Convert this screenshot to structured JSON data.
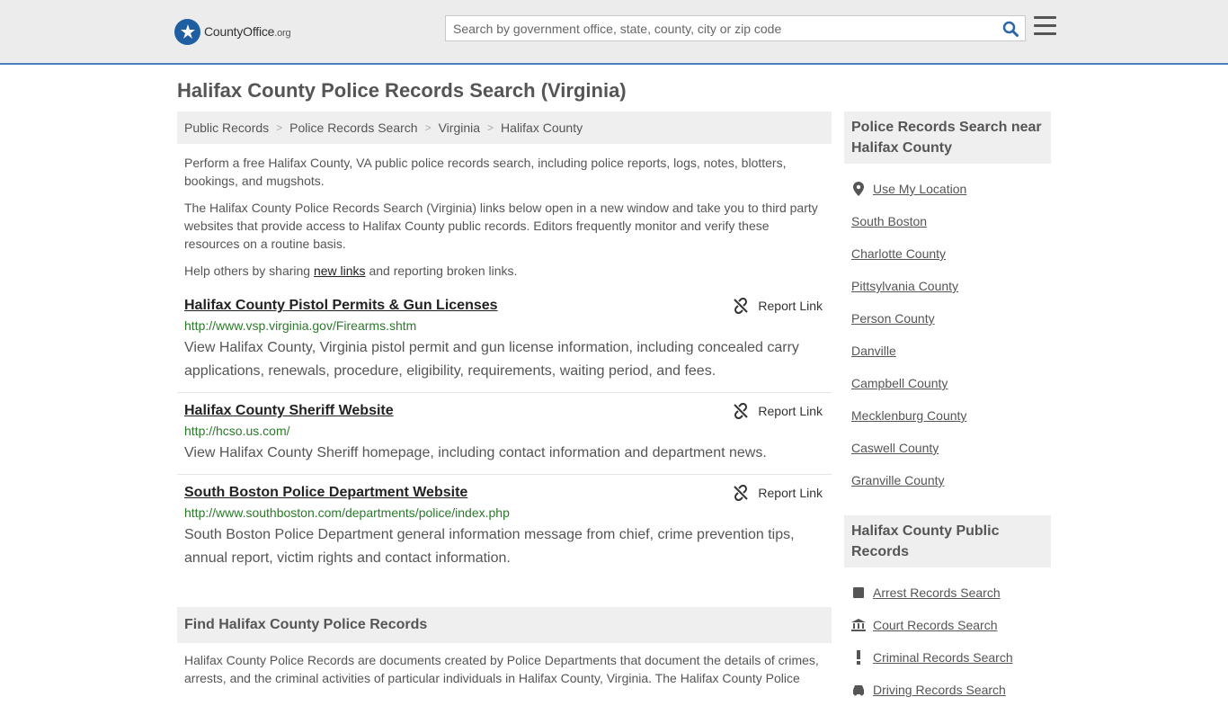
{
  "header": {
    "logo_text": "CountyOffice",
    "logo_tld": ".org",
    "search_placeholder": "Search by government office, state, county, city or zip code"
  },
  "page": {
    "title": "Halifax County Police Records Search (Virginia)"
  },
  "breadcrumb": [
    "Public Records",
    "Police Records Search",
    "Virginia",
    "Halifax County"
  ],
  "intro": {
    "p1": "Perform a free Halifax County, VA public police records search, including police reports, logs, notes, blotters, bookings, and mugshots.",
    "p2": "The Halifax County Police Records Search (Virginia) links below open in a new window and take you to third party websites that provide access to Halifax County public records. Editors frequently monitor and verify these resources on a routine basis.",
    "p3_before": "Help others by sharing ",
    "p3_link": "new links",
    "p3_after": " and reporting broken links."
  },
  "report_label": "Report Link",
  "results": [
    {
      "title": "Halifax County Pistol Permits & Gun Licenses",
      "url": "http://www.vsp.virginia.gov/Firearms.shtm",
      "desc": "View Halifax County, Virginia pistol permit and gun license information, including concealed carry applications, renewals, procedure, eligibility, requirements, waiting period, and fees."
    },
    {
      "title": "Halifax County Sheriff Website",
      "url": "http://hcso.us.com/",
      "desc": "View Halifax County Sheriff homepage, including contact information and department news."
    },
    {
      "title": "South Boston Police Department Website",
      "url": "http://www.southboston.com/departments/police/index.php",
      "desc": "South Boston Police Department general information message from chief, crime prevention tips, annual report, victim rights and contact information."
    }
  ],
  "find": {
    "heading": "Find Halifax County Police Records",
    "text": "Halifax County Police Records are documents created by Police Departments that document the details of crimes, arrests, and the criminal activities of particular individuals in Halifax County, Virginia. The Halifax County Police"
  },
  "sidebar": {
    "near_heading": "Police Records Search near Halifax County",
    "use_location": "Use My Location",
    "near_items": [
      "South Boston",
      "Charlotte County",
      "Pittsylvania County",
      "Person County",
      "Danville",
      "Campbell County",
      "Mecklenburg County",
      "Caswell County",
      "Granville County"
    ],
    "public_heading": "Halifax County Public Records",
    "public_items": [
      {
        "label": "Arrest Records Search",
        "icon": "square-icon"
      },
      {
        "label": "Court Records Search",
        "icon": "courthouse-icon"
      },
      {
        "label": "Criminal Records Search",
        "icon": "exclamation-icon"
      },
      {
        "label": "Driving Records Search",
        "icon": "car-icon"
      }
    ]
  },
  "colors": {
    "accent": "#4a7fbf",
    "url_green": "#2a7a2a",
    "header_bg": "#ececec",
    "box_bg": "#efefef"
  }
}
